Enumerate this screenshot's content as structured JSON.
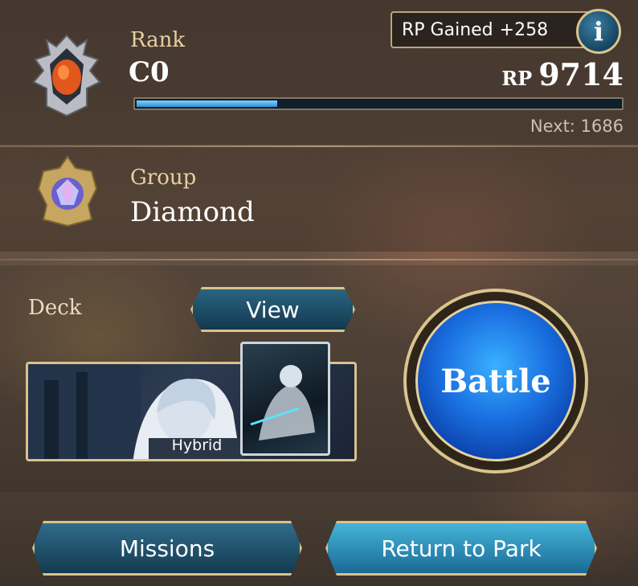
{
  "rank": {
    "label": "Rank",
    "value": "C0",
    "rp_gained_label": "RP Gained",
    "rp_gained_value": "+258",
    "rp_unit": "RP",
    "rp_value": "9714",
    "progress_fraction": 0.29,
    "next_text": "Next: 1686",
    "info_label": "i"
  },
  "group": {
    "label": "Group",
    "value": "Diamond"
  },
  "deck": {
    "label": "Deck",
    "view_button": "View",
    "deck_type": "Hybrid"
  },
  "battle_button": "Battle",
  "bottom": {
    "missions_button": "Missions",
    "return_button": "Return to Park"
  },
  "icons": {
    "rank_emblem": "rank-emblem-icon",
    "group_emblem": "diamond-emblem-icon",
    "info": "info-icon"
  },
  "colors": {
    "accent_gold": "#d8c38c",
    "progress_fill": "#2f8fd6",
    "battle_blue": "#1a6fe0",
    "label_gold": "#e7cfa0"
  }
}
